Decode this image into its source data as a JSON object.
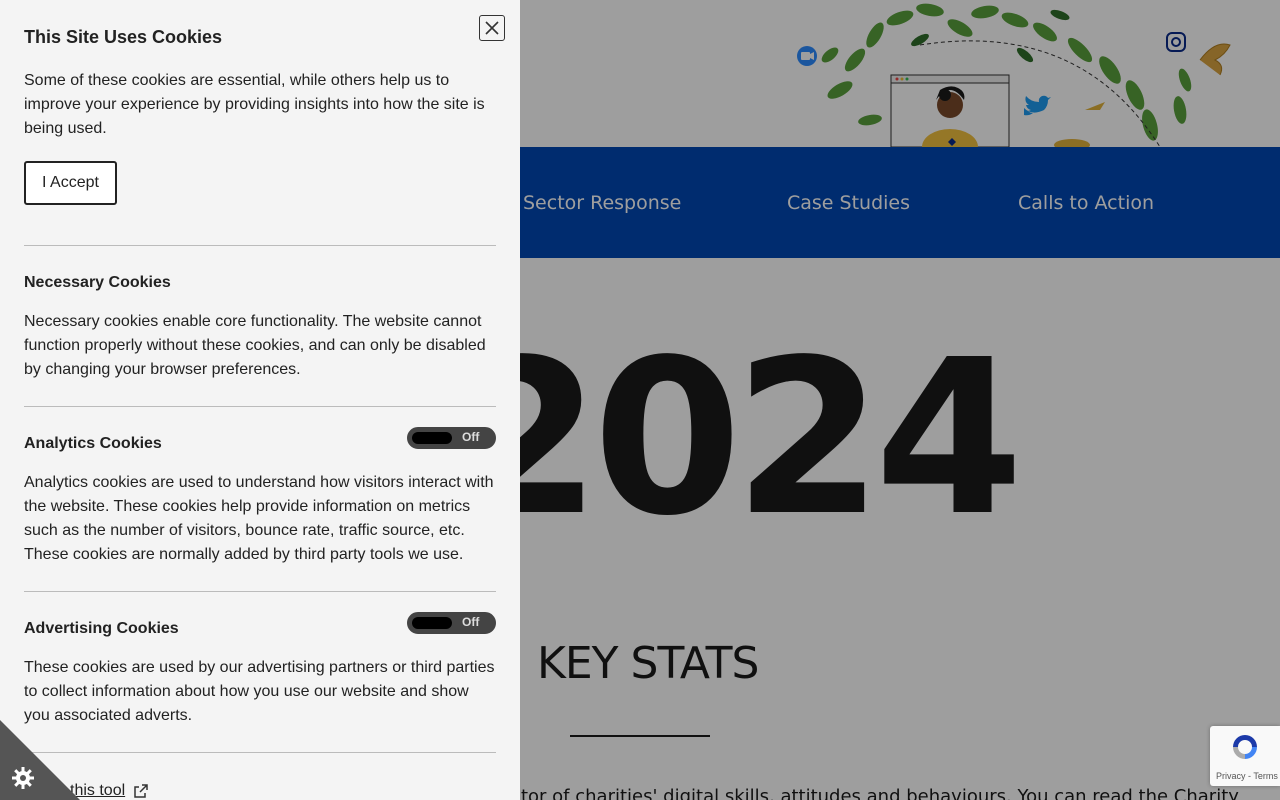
{
  "page": {
    "nav": {
      "items": [
        "Sector Response",
        "Case Studies",
        "Calls to Action"
      ]
    },
    "hero": {
      "year_text": "2024"
    },
    "key_stats": {
      "heading": "KEY STATS",
      "body_snippet": "ector of charities' digital skills, attitudes and behaviours. You can read the Charity"
    },
    "recaptcha": {
      "links": "Privacy - Terms"
    }
  },
  "cookie_panel": {
    "title": "This Site Uses Cookies",
    "intro": "Some of these cookies are essential, while others help us to improve your experience by providing insights into how the site is being used.",
    "accept_label": "I Accept",
    "sections": [
      {
        "title": "Necessary Cookies",
        "description": "Necessary cookies enable core functionality. The website cannot function properly without these cookies, and can only be disabled by changing your browser preferences."
      },
      {
        "title": "Analytics Cookies",
        "toggle": "Off",
        "description": "Analytics cookies are used to understand how visitors interact with the website. These cookies help provide information on metrics such as the number of visitors, bounce rate, traffic source, etc. These cookies are normally added by third party tools we use."
      },
      {
        "title": "Advertising Cookies",
        "toggle": "Off",
        "description": "These cookies are used by our advertising partners or third parties to collect information about how you use our website and show you associated adverts."
      }
    ],
    "about_link": "this tool"
  },
  "colors": {
    "nav_blue": "#0047b3",
    "panel_bg": "#f4f4f4",
    "toggle_bg": "#444444"
  },
  "icons": [
    "close-icon",
    "external-link-icon",
    "cookie-settings-icon",
    "recaptcha-icon",
    "instagram-icon",
    "twitter-icon",
    "zoom-icon"
  ]
}
